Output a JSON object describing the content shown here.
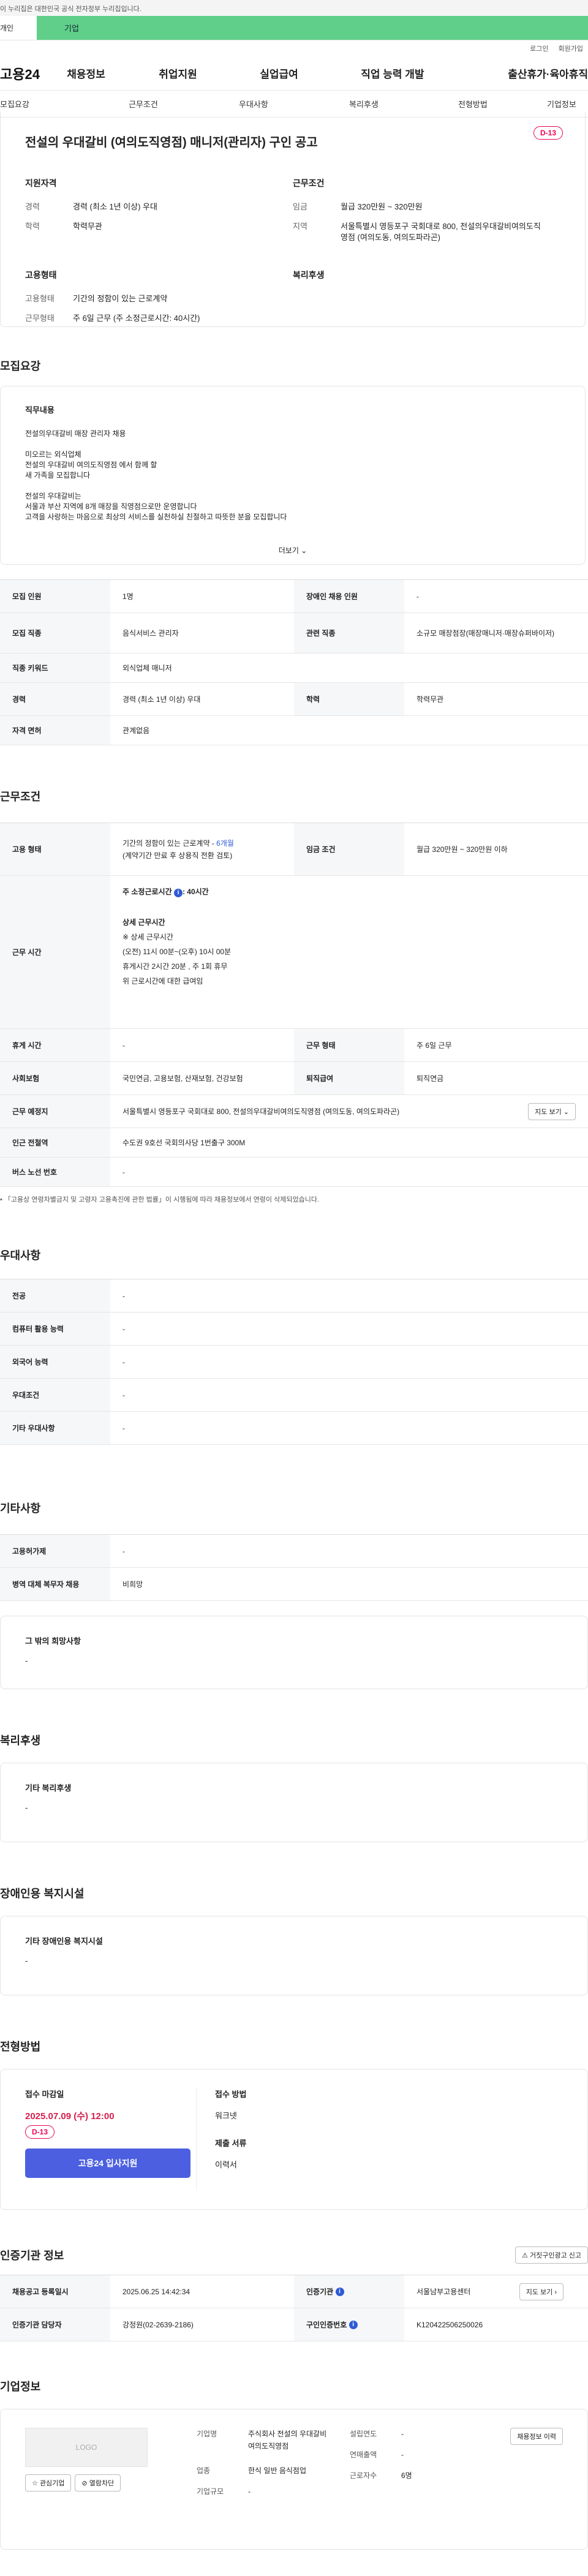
{
  "gov_banner": "이 누리집은 대한민국 공식 전자정부 누리집입니다.",
  "segments": {
    "left": "개인",
    "right": "기업"
  },
  "util_links": [
    "로그인",
    "회원가입"
  ],
  "site_logo": "고용24",
  "gnb": [
    "채용정보",
    "취업지원",
    "실업급여",
    "직업 능력 개발",
    "출산휴가·육아휴직"
  ],
  "lnb": [
    "모집요강",
    "근무조건",
    "우대사항",
    "복리후생",
    "전형방법",
    "기업정보"
  ],
  "summary": {
    "title": "전설의 우대갈비 (여의도직영점) 매니저(관리자) 구인 공고",
    "dday": "D-13",
    "qual_title": "지원자격",
    "qual": [
      {
        "k": "경력",
        "v": "경력 (최소 1년 이상) 우대"
      },
      {
        "k": "학력",
        "v": "학력무관"
      }
    ],
    "cond_title": "근무조건",
    "cond": [
      {
        "k": "임금",
        "v": "월급 320만원 ~ 320만원"
      },
      {
        "k": "지역",
        "v": "서울특별시 영등포구 국회대로 800, 전설의우대갈비여의도직영점 (여의도동, 여의도파라곤)"
      }
    ],
    "emp_title": "고용형태",
    "emp": [
      {
        "k": "고용형태",
        "v": "기간의 정함이 있는 근로계약"
      },
      {
        "k": "근무형태",
        "v": "주 6일 근무 (주 소정근로시간: 40시간)"
      }
    ],
    "welfare_title": "복리후생"
  },
  "recruit": {
    "title": "모집요강",
    "job_content_title": "직무내용",
    "job_lines": [
      "전설의우대갈비 매장 관리자 채용",
      "",
      "미오르는 외식업체",
      "전설의 우대갈비 여의도직영점 에서 함께 할",
      "새 가족을 모집합니다",
      "",
      "전설의 우대갈비는",
      "서울과 부산 지역에 8개 매장을 직영점으로만 운영합니다",
      "고객을 사랑하는 마음으로 최상의 서비스를 실천하실 친절하고 따뜻한 분을 모집합니다"
    ],
    "more": "더보기",
    "rows": [
      {
        "k1": "모집 인원",
        "v1": "1명",
        "k2": "장애인 채용 인원",
        "v2": "-"
      },
      {
        "k1": "모집 직종",
        "v1": "음식서비스 관리자",
        "k2": "관련 직종",
        "v2": "소규모 매장점장(매장매니저·매장슈퍼바이저)"
      },
      {
        "k1": "직종 키워드",
        "v1": "외식업체 매니저"
      },
      {
        "k1": "경력",
        "v1": "경력 (최소 1년 이상) 우대",
        "k2": "학력",
        "v2": "학력무관"
      },
      {
        "k1": "자격 면허",
        "v1": "관계없음"
      }
    ]
  },
  "work": {
    "title": "근무조건",
    "emp_type_k": "고용 형태",
    "emp_type_v": "기간의 정함이 있는 근로계약 - ",
    "emp_type_months": "6개월",
    "emp_type_note": "(계약기간 만료 후 상용직 전환 검토)",
    "wage_k": "임금 조건",
    "wage_v": "월급 320만원 ~ 320만원 이하",
    "hours_k": "근무 시간",
    "hours_main": "주 소정근로시간",
    "hours_value": ": 40시간",
    "hours_detail_title": "상세 근무시간",
    "hours_detail": [
      "※ 상세 근무시간",
      "(오전) 11시 00분~(오후) 10시 00분",
      "휴게시간 2시간 20분 , 주 1회 휴무",
      "위 근로시간에 대한 급여임"
    ],
    "rest_k": "휴게 시간",
    "rest_v": "-",
    "worktype_k": "근무 형태",
    "worktype_v": "주 6일 근무",
    "insurance_k": "사회보험",
    "insurance_v": "국민연금, 고용보험, 산재보험, 건강보험",
    "retire_k": "퇴직급여",
    "retire_v": "퇴직연금",
    "place_k": "근무 예정지",
    "place_v": "서울특별시 영등포구 국회대로 800, 전설의우대갈비여의도직영점 (여의도동, 여의도파라곤)",
    "map_btn": "지도 보기",
    "subway_k": "인근 전철역",
    "subway_v": "수도권 9호선 국회의사당 1번출구 300M",
    "bus_k": "버스 노선 번호",
    "bus_v": "-",
    "footnote": "「고용상 연령차별금지 및 고령자 고용촉진에 관한 법률」이 시행됨에 따라 채용정보에서 연령이 삭제되었습니다."
  },
  "pref": {
    "title": "우대사항",
    "rows": [
      {
        "k": "전공",
        "v": "-"
      },
      {
        "k": "컴퓨터 활용 능력",
        "v": "-"
      },
      {
        "k": "외국어 능력",
        "v": "-"
      },
      {
        "k": "우대조건",
        "v": "-"
      },
      {
        "k": "기타 우대사항",
        "v": "-"
      }
    ]
  },
  "etc": {
    "title": "기타사항",
    "rows": [
      {
        "k": "고용허가제",
        "v": "-"
      },
      {
        "k": "병역 대체 복무자 채용",
        "v": "비희망"
      }
    ],
    "hope_title": "그 밖의 희망사항",
    "hope_v": "-"
  },
  "welfare": {
    "title": "복리후생",
    "box_title": "기타 복리후생",
    "box_v": "-"
  },
  "disabled": {
    "title": "장애인용 복지시설",
    "box_title": "기타 장애인용 복지시설",
    "box_v": "-"
  },
  "process": {
    "title": "전형방법",
    "deadline_title": "접수 마감일",
    "deadline": "2025.07.09 (수) 12:00",
    "dday": "D-13",
    "apply_btn": "고용24 입사지원",
    "method_title": "접수 방법",
    "method_v": "워크넷",
    "docs_title": "제출 서류",
    "docs_v": "이력서"
  },
  "cert": {
    "title": "인증기관 정보",
    "report_btn": "거짓구인광고 신고",
    "reg_k": "채용공고 등록일시",
    "reg_v": "2025.06.25 14:42:34",
    "org_k": "인증기관",
    "org_v": "서울남부고용센터",
    "map_btn": "지도 보기",
    "mgr_k": "인증기관 담당자",
    "mgr_v": "강정원(02-2639-2186)",
    "num_k": "구인인증번호",
    "num_v": "K120422506250026"
  },
  "company": {
    "title": "기업정보",
    "logo": "LOGO",
    "fav_btn": "관심기업",
    "block_btn": "열람차단",
    "name_k": "기업명",
    "name_v": "주식회사 전설의 우대갈비 여의도직영점",
    "year_k": "설립연도",
    "year_v": "-",
    "sales_k": "연매출액",
    "sales_v": "-",
    "staff_k": "근로자수",
    "staff_v": "6명",
    "industry_k": "업종",
    "industry_v": "한식 일반 음식점업",
    "size_k": "기업규모",
    "size_v": "-",
    "info_btn": "채용정보 이력"
  }
}
